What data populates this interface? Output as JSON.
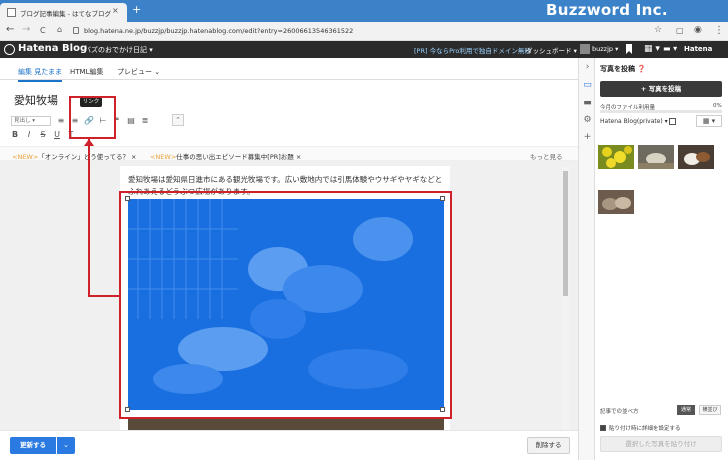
{
  "browser": {
    "tab_title": "ブログ記事編集 - はてなブログ",
    "tab_close": "×",
    "new_tab": "+",
    "url": "blog.hatena.ne.jp/buzzjp/buzzjp.hatenablog.com/edit?entry=26006613546361522",
    "banner": "Buzzword Inc.",
    "nav": {
      "back": "←",
      "forward": "→",
      "reload": "C",
      "star": "☆",
      "menu": "⋮"
    }
  },
  "header": {
    "logo": "Hatena Blog",
    "blog_name": "バズのおでかけ日記 ▾",
    "promo": "[PR] 今ならPro利用で独自ドメイン無料",
    "dashboard": "ダッシュボード ▾",
    "user": "buzzjp ▾",
    "grid": "▦ ▾",
    "msg": "▬ ▾",
    "hatena": "Hatena"
  },
  "editor": {
    "tabs": [
      "編集 見たまま",
      "HTML編集",
      "プレビュー ⌄"
    ],
    "title": "愛知牧場",
    "format_select": "見出し ▾",
    "toolbar_row1": [
      "≡",
      "≡",
      "🔗",
      "⊢",
      "❝",
      "▤",
      "≣"
    ],
    "toolbar_row2": [
      "B",
      "I",
      "S",
      "U",
      "T"
    ],
    "collapse": "⌃",
    "tooltip": "リンク",
    "tips": [
      {
        "badge": "<NEW>",
        "text": "「オンライン」どう使ってる？ ×"
      },
      {
        "badge": "<NEW>",
        "text": "仕事の思い出エピソード募集中[PR]お題 ×"
      }
    ],
    "tips_more": "もっと見る",
    "body_text": "愛知牧場は愛知県日進市にある観光牧場です。広い敷地内では引馬体験やウサギやヤギなどとふれあえるどうぶつ広場があります。",
    "update_button": "更新する",
    "update_dropdown": "⌄",
    "delete_button": "削除する"
  },
  "rail": {
    "icons": [
      "›",
      "▭",
      "▬",
      "⚙",
      "+"
    ]
  },
  "panel": {
    "title": "写真を投稿 ❓",
    "post_button": "+ 写真を投稿",
    "usage_label": "今月のファイル利用量",
    "usage_value": "0%",
    "usage_fraction": 0.0,
    "album": "Hatena Blog(private) ▾",
    "view_toggle": "▦ ▾",
    "sort_label": "記事での並べ方",
    "sort_options": [
      "通常",
      "横並び"
    ],
    "paste_detail_label": "貼り付け時に詳細を設定する",
    "paste_button": "選択した写真を貼り付け"
  },
  "colors": {
    "accent": "#2a7ae2",
    "annotation": "#d0202a",
    "chrome": "#3b82c8",
    "header": "#2b2b2b",
    "photo_tint": "#1a6fe0"
  }
}
